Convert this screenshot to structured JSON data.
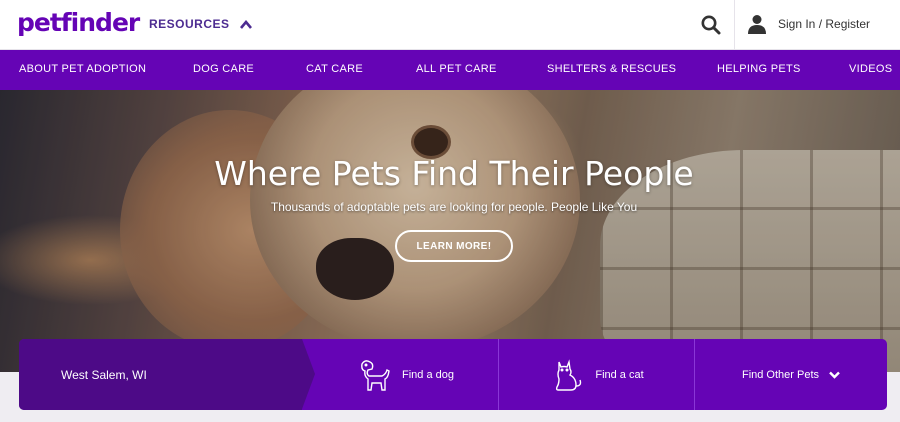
{
  "header": {
    "logo": "petfinder",
    "resources_label": "RESOURCES",
    "signin_label": "Sign In / Register"
  },
  "nav": [
    "ABOUT PET ADOPTION",
    "DOG CARE",
    "CAT CARE",
    "ALL PET CARE",
    "SHELTERS & RESCUES",
    "HELPING PETS",
    "VIDEOS"
  ],
  "hero": {
    "title": "Where Pets Find Their People",
    "subtitle": "Thousands of adoptable pets are looking for people. People Like You",
    "button_label": "LEARN MORE!"
  },
  "search": {
    "location": "West Salem, WI",
    "find_dog": "Find a dog",
    "find_cat": "Find a cat",
    "find_other": "Find Other Pets"
  },
  "icons": {
    "resources_toggle": "chevron-up-icon",
    "search": "search-icon",
    "account": "user-icon",
    "dog": "dog-icon",
    "cat": "cat-icon",
    "other_toggle": "chevron-down-icon"
  },
  "colors": {
    "brand_purple": "#6504b5",
    "dark_purple": "#4d0a87",
    "logo_purple": "#6504b5",
    "background": "#ffffff"
  }
}
